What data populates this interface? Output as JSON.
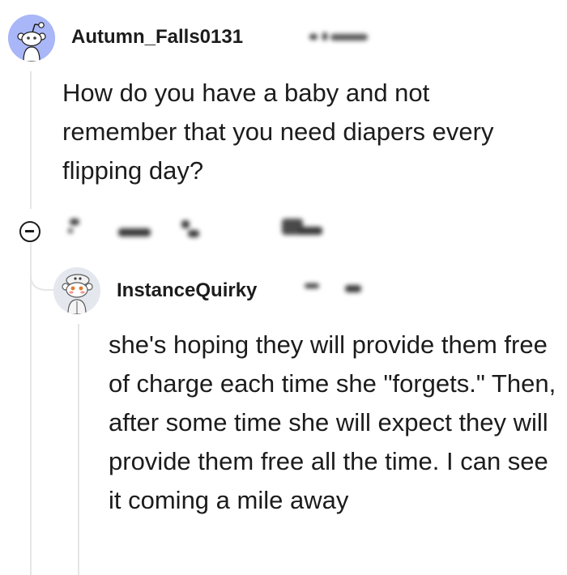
{
  "comment": {
    "username": "Autumn_Falls0131",
    "body": "How do you have a baby and not remember that you need diapers every flipping day?"
  },
  "reply": {
    "username": "InstanceQuirky",
    "body": "she's hoping they will provide them free of charge each time she \"forgets.\" Then, after some time she will expect they will provide them free all the time. I can see it coming a mile away"
  },
  "icons": {
    "collapse": "collapse-icon",
    "avatar_default": "snoo-avatar-icon",
    "avatar_custom": "snoo-custom-avatar-icon"
  },
  "colors": {
    "avatar_bg": "#a9b6f7",
    "thread_line": "#e6e6e6",
    "text": "#1c1c1c"
  }
}
